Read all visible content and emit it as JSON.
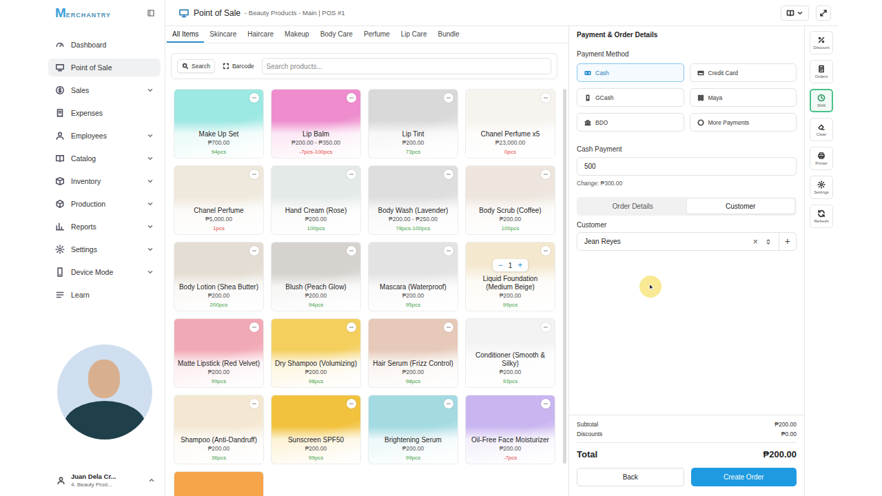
{
  "logo": {
    "mark": "M",
    "text": "ERCHANTRY"
  },
  "header": {
    "title": "Point of Sale",
    "subtitle": "- Beauty Products - Main | POS #1"
  },
  "sidebar": {
    "items": [
      {
        "label": "Dashboard",
        "selected": false,
        "expandable": false
      },
      {
        "label": "Point of Sale",
        "selected": true,
        "expandable": false
      },
      {
        "label": "Sales",
        "selected": false,
        "expandable": true
      },
      {
        "label": "Expenses",
        "selected": false,
        "expandable": false
      },
      {
        "label": "Employees",
        "selected": false,
        "expandable": true
      },
      {
        "label": "Catalog",
        "selected": false,
        "expandable": true
      },
      {
        "label": "Inventory",
        "selected": false,
        "expandable": true
      },
      {
        "label": "Production",
        "selected": false,
        "expandable": true
      },
      {
        "label": "Reports",
        "selected": false,
        "expandable": true
      },
      {
        "label": "Settings",
        "selected": false,
        "expandable": true
      },
      {
        "label": "Device Mode",
        "selected": false,
        "expandable": true
      },
      {
        "label": "Learn",
        "selected": false,
        "expandable": false
      }
    ],
    "user": {
      "name": "Juan Dela Cr...",
      "store": "4. Beauty Prod..."
    }
  },
  "categories": [
    {
      "label": "All Items",
      "selected": true
    },
    {
      "label": "Skincare",
      "selected": false
    },
    {
      "label": "Haircare",
      "selected": false
    },
    {
      "label": "Makeup",
      "selected": false
    },
    {
      "label": "Body Care",
      "selected": false
    },
    {
      "label": "Perfume",
      "selected": false
    },
    {
      "label": "Lip Care",
      "selected": false
    },
    {
      "label": "Bundle",
      "selected": false
    }
  ],
  "search": {
    "modes": [
      {
        "label": "Search",
        "selected": true
      },
      {
        "label": "Barcode",
        "selected": false
      }
    ],
    "placeholder": "Search products..."
  },
  "products": [
    {
      "kind": "card",
      "name": "Make Up Set",
      "price": "₱700.00",
      "stock": "94pcs",
      "stock_color": "#3f9f46",
      "color": "#9ce8e2",
      "in_cart": false
    },
    {
      "kind": "card",
      "name": "Lip Balm",
      "price": "₱200.00 - ₱350.00",
      "stock": "-7pcs-100pcs",
      "stock_color": "#e0483e",
      "color": "#ee8ccd",
      "in_cart": false
    },
    {
      "kind": "card",
      "name": "Lip Tint",
      "price": "₱200.00",
      "stock": "73pcs",
      "stock_color": "#3f9f46",
      "color": "#d9d9d9",
      "in_cart": false
    },
    {
      "kind": "card",
      "name": "Chanel Perfume x5",
      "price": "₱23,000.00",
      "stock": "0pcs",
      "stock_color": "#e0483e",
      "color": "#f7f3ee",
      "in_cart": false
    },
    {
      "kind": "card",
      "name": "Chanel Perfume",
      "price": "₱5,000.00",
      "stock": "1pcs",
      "stock_color": "#e0483e",
      "color": "#efe8dc",
      "in_cart": false
    },
    {
      "kind": "card",
      "name": "Hand Cream (Rose)",
      "price": "₱200.00",
      "stock": "100pcs",
      "stock_color": "#3f9f46",
      "color": "#e4eae7",
      "in_cart": false
    },
    {
      "kind": "card",
      "name": "Body Wash (Lavender)",
      "price": "₱200.00 - ₱250.00",
      "stock": "78pcs-100pcs",
      "stock_color": "#3f9f46",
      "color": "#dedede",
      "in_cart": false
    },
    {
      "kind": "card",
      "name": "Body Scrub (Coffee)",
      "price": "₱200.00",
      "stock": "100pcs",
      "stock_color": "#3f9f46",
      "color": "#eee6de",
      "in_cart": false
    },
    {
      "kind": "card",
      "name": "Body Lotion (Shea Butter)",
      "price": "₱200.00",
      "stock": "200pcs",
      "stock_color": "#3f9f46",
      "color": "#e4ddd3",
      "in_cart": false
    },
    {
      "kind": "card",
      "name": "Blush (Peach Glow)",
      "price": "₱200.00",
      "stock": "94pcs",
      "stock_color": "#3f9f46",
      "color": "#d6d2ce",
      "in_cart": false
    },
    {
      "kind": "card",
      "name": "Mascara (Waterproof)",
      "price": "₱200.00",
      "stock": "95pcs",
      "stock_color": "#3f9f46",
      "color": "#e3e3e3",
      "in_cart": false
    },
    {
      "kind": "card",
      "name": "Liquid Foundation (Medium Beige)",
      "price": "₱200.00",
      "stock": "99pcs",
      "stock_color": "#3f9f46",
      "color": "#f4e9cf",
      "in_cart": true,
      "quantity": "1",
      "minus": "−",
      "plus": "+"
    },
    {
      "kind": "card",
      "name": "Matte Lipstick (Red Velvet)",
      "price": "₱200.00",
      "stock": "99pcs",
      "stock_color": "#3f9f46",
      "color": "#f2a9b6",
      "in_cart": false
    },
    {
      "kind": "card",
      "name": "Dry Shampoo (Volumizing)",
      "price": "₱200.00",
      "stock": "98pcs",
      "stock_color": "#3f9f46",
      "color": "#f4cf5e",
      "in_cart": false
    },
    {
      "kind": "card",
      "name": "Hair Serum (Frizz Control)",
      "price": "₱200.00",
      "stock": "98pcs",
      "stock_color": "#3f9f46",
      "color": "#e6c9b8",
      "in_cart": false
    },
    {
      "kind": "card",
      "name": "Conditioner (Smooth & Silky)",
      "price": "₱200.00",
      "stock": "93pcs",
      "stock_color": "#3f9f46",
      "color": "#f3f3f3",
      "in_cart": false
    },
    {
      "kind": "card",
      "name": "Shampoo (Anti-Dandruff)",
      "price": "₱200.00",
      "stock": "36pcs",
      "stock_color": "#3f9f46",
      "color": "#f5e8d2",
      "in_cart": false
    },
    {
      "kind": "card",
      "name": "Sunscreen SPF50",
      "price": "₱200.00",
      "stock": "99pcs",
      "stock_color": "#3f9f46",
      "color": "#f2c23e",
      "in_cart": false
    },
    {
      "kind": "card",
      "name": "Brightening Serum",
      "price": "₱200.00",
      "stock": "99pcs",
      "stock_color": "#3f9f46",
      "color": "#a4dbe2",
      "in_cart": false
    },
    {
      "kind": "card",
      "name": "Oil-Free Face Moisturizer",
      "price": "₱200.00",
      "stock": "-7pcs",
      "stock_color": "#e0483e",
      "color": "#c9b6f0",
      "in_cart": false
    },
    {
      "kind": "image-only",
      "color": "#f6a54a",
      "in_cart": false
    }
  ],
  "payment": {
    "title": "Payment & Order Details",
    "method_label": "Payment Method",
    "methods": [
      {
        "label": "Cash",
        "selected": true
      },
      {
        "label": "Credit Card",
        "selected": false
      },
      {
        "label": "GCash",
        "selected": false
      },
      {
        "label": "Maya",
        "selected": false
      },
      {
        "label": "BDO",
        "selected": false
      },
      {
        "label": "More Payments",
        "selected": false
      }
    ],
    "cash_label": "Cash Payment",
    "cash_value": "500",
    "change": "Change: ₱300.00"
  },
  "order_tabs": [
    {
      "label": "Order Details",
      "selected": false
    },
    {
      "label": "Customer",
      "selected": true
    }
  ],
  "customer": {
    "label": "Customer",
    "value": "Jean Reyes",
    "clear": "×",
    "add": "+"
  },
  "summary": {
    "subtotal_label": "Subtotal",
    "subtotal": "₱200.00",
    "discounts_label": "Discounts",
    "discounts": "₱0.00",
    "total_label": "Total",
    "total": "₱200.00"
  },
  "actions": {
    "back": "Back",
    "create": "Create Order"
  },
  "rail": [
    {
      "label": "Discount",
      "selected": false
    },
    {
      "label": "Orders",
      "selected": false
    },
    {
      "label": "Shift",
      "selected": true
    },
    {
      "label": "Clear",
      "selected": false
    },
    {
      "label": "Printer",
      "selected": false
    },
    {
      "label": "Settings",
      "selected": false
    },
    {
      "label": "Refresh",
      "selected": false
    }
  ]
}
